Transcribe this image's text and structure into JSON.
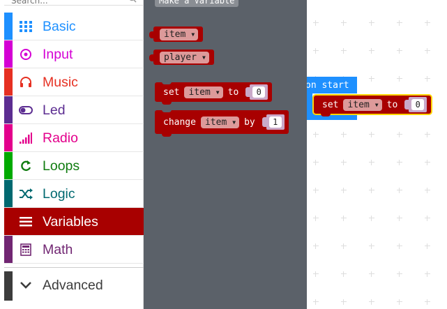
{
  "toolbox": {
    "search_placeholder": "Search...",
    "categories": [
      {
        "label": "Basic",
        "color": "#1E90FF",
        "icon": "grid-icon"
      },
      {
        "label": "Input",
        "color": "#D400D4",
        "icon": "target-icon"
      },
      {
        "label": "Music",
        "color": "#E63022",
        "icon": "headphones-icon"
      },
      {
        "label": "Led",
        "color": "#5C2D91",
        "icon": "toggle-icon"
      },
      {
        "label": "Radio",
        "color": "#E3008C",
        "icon": "signal-bars-icon"
      },
      {
        "label": "Loops",
        "color": "#00AA00",
        "icon": "refresh-icon"
      },
      {
        "label": "Logic",
        "color": "#00A4A6",
        "icon": "shuffle-icon"
      },
      {
        "label": "Variables",
        "color": "#DC143C",
        "icon": "list-icon"
      },
      {
        "label": "Math",
        "color": "#9400D3",
        "icon": "calculator-icon"
      },
      {
        "label": "Advanced",
        "color": "#3C3C3C",
        "icon": "chevron-down-icon"
      }
    ],
    "label_colors": [
      "#1E90FF",
      "#D400D4",
      "#E63022",
      "#5C2D91",
      "#E3008C",
      "#00AA00",
      "#00A4A6",
      "#FFFFFF",
      "#9400D3",
      "#3C3C3C"
    ],
    "stripe_colors": [
      "#1E90FF",
      "#D400D4",
      "#E63022",
      "#5C2D91",
      "#E3008C",
      "#00AA00",
      "#00A4A6",
      "#A80000",
      "#9400D3",
      "#3C3C3C"
    ]
  },
  "flyout": {
    "make_variable_label": "Make a Variable",
    "var_item": "item",
    "var_player": "player",
    "set_block": {
      "keyword": "set",
      "variable": "item",
      "to": "to",
      "value": "0"
    },
    "change_block": {
      "keyword": "change",
      "variable": "item",
      "by": "by",
      "value": "1"
    }
  },
  "workspace": {
    "on_start_label": "on start",
    "set_block": {
      "keyword": "set",
      "variable": "item",
      "to": "to",
      "value": "0"
    }
  },
  "colors": {
    "variables": "#A80000",
    "basic": "#1E90FF",
    "flyout_bg": "#5b6169",
    "variable_field": "#dd9a9a"
  }
}
